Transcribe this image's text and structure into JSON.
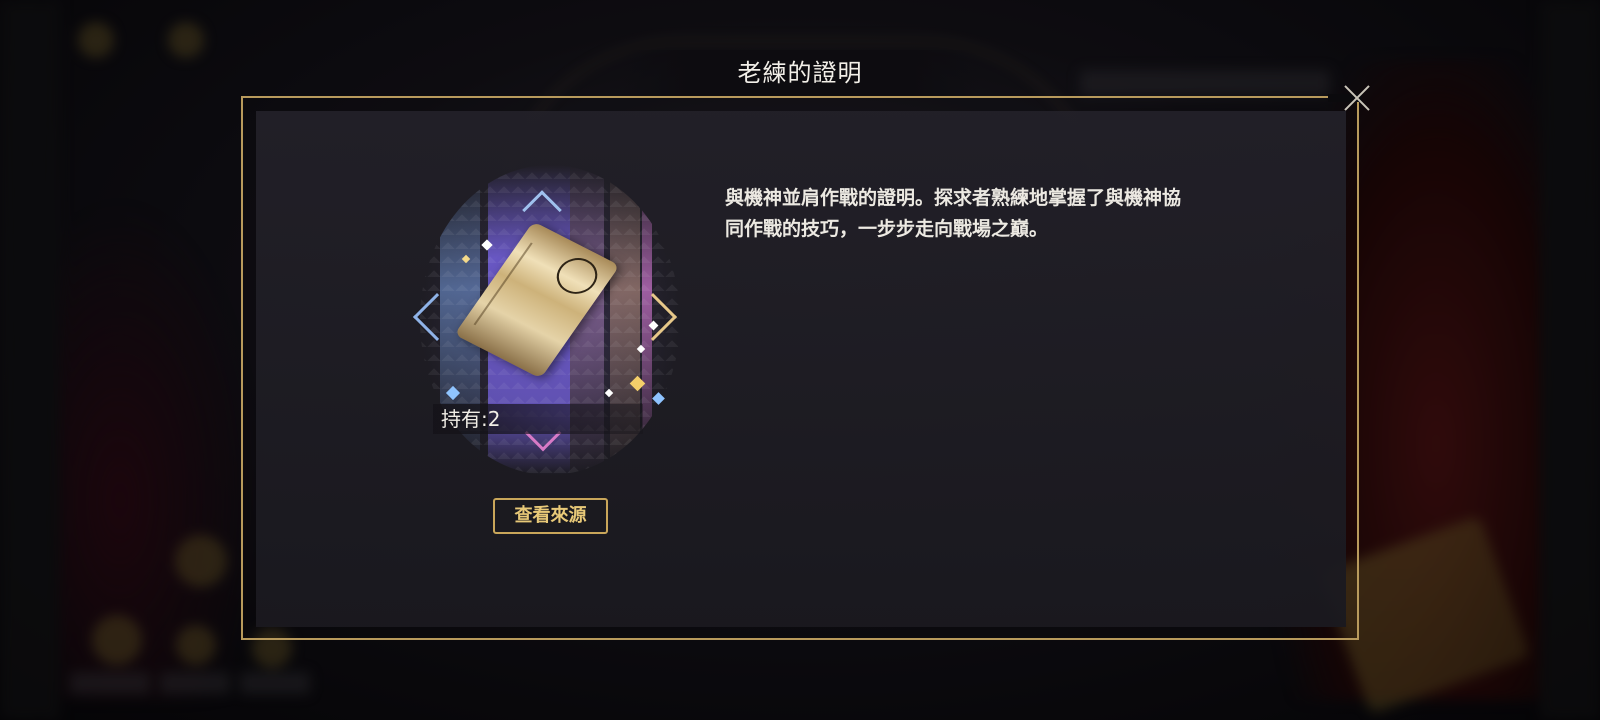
{
  "dialog": {
    "title": "老練的證明",
    "close_icon": "close-icon",
    "description": "與機神並肩作戰的證明。探求者熟練地掌握了與機神協同作戰的技巧，一步步走向戰場之巔。"
  },
  "item": {
    "icon": "gold-card-icon",
    "held_text": "持有:2",
    "source_button": "查看來源"
  },
  "colors": {
    "frame_gold": "#b89a5c",
    "button_gold": "#e8c978",
    "panel_bg": "#222028",
    "text": "#ece9e2"
  }
}
